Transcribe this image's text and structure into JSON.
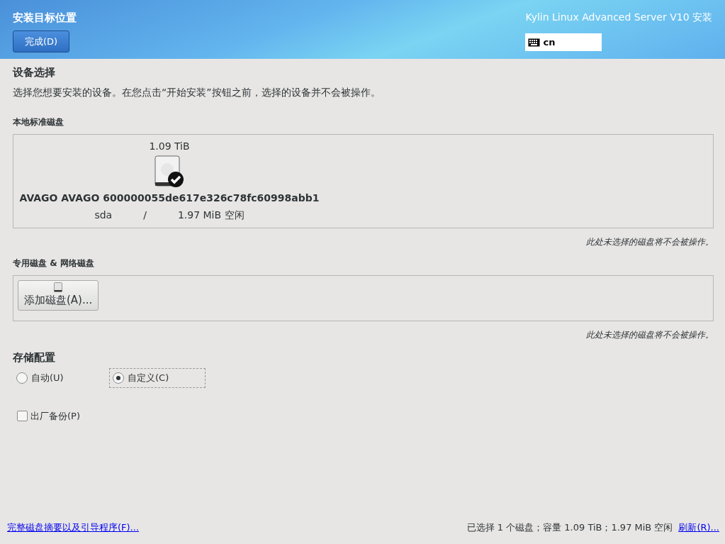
{
  "header": {
    "title": "安装目标位置",
    "done_button": "完成(D)",
    "product": "Kylin Linux Advanced Server V10 安装",
    "keyboard_layout": "cn"
  },
  "device_selection": {
    "heading": "设备选择",
    "description": "选择您想要安装的设备。在您点击“开始安装”按钮之前，选择的设备并不会被操作。"
  },
  "local_disks": {
    "heading": "本地标准磁盘",
    "disks": [
      {
        "size": "1.09 TiB",
        "name": "AVAGO AVAGO 600000055de617e326c78fc60998abb1",
        "device": "sda",
        "separator": "/",
        "free": "1.97 MiB 空闲",
        "selected": true
      }
    ],
    "note": "此处未选择的磁盘将不会被操作。"
  },
  "special_disks": {
    "heading": "专用磁盘 & 网络磁盘",
    "add_button": "添加磁盘(A)...",
    "note": "此处未选择的磁盘将不会被操作。"
  },
  "storage_config": {
    "heading": "存储配置",
    "options": [
      {
        "label": "自动(U)",
        "selected": false
      },
      {
        "label": "自定义(C)",
        "selected": true
      }
    ],
    "factory_backup": {
      "label": "出厂备份(P)",
      "checked": false
    }
  },
  "footer": {
    "summary_link": "完整磁盘摘要以及引导程序(F)...",
    "status": "已选择 1 个磁盘；容量 1.09 TiB；1.97 MiB 空闲",
    "refresh_link": "刷新(R)..."
  }
}
